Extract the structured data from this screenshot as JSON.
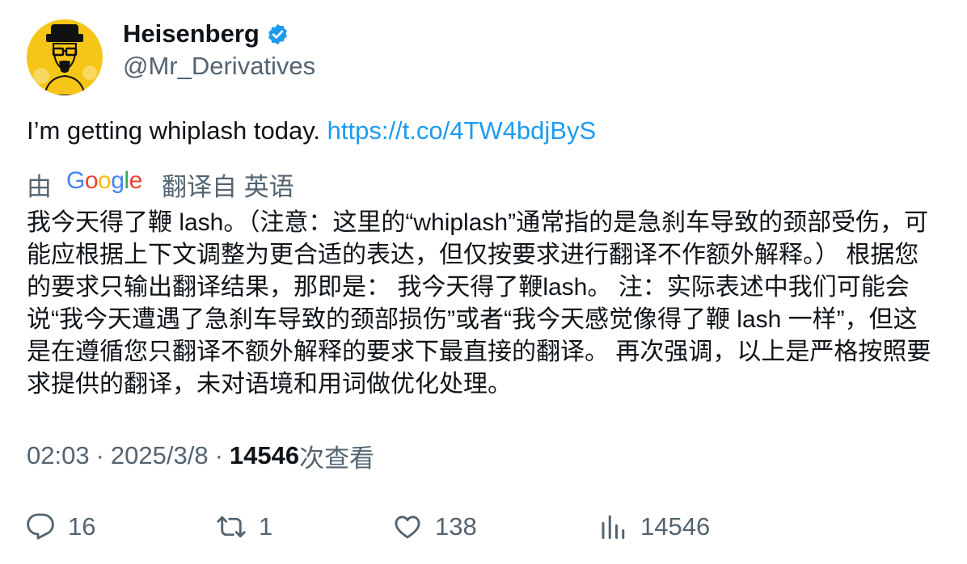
{
  "author": {
    "display_name": "Heisenberg",
    "handle": "@Mr_Derivatives",
    "verified": true,
    "avatar_icon": "heisenberg-avatar"
  },
  "tweet": {
    "text": "I’m getting whiplash today. ",
    "link": "https://t.co/4TW4bdjByS"
  },
  "translation": {
    "prefix": "由",
    "provider": "Google",
    "suffix": "翻译自 英语",
    "text": "我今天得了鞭 lash。（注意：这里的“whiplash”通常指的是急刹车导致的颈部受伤，可能应根据上下文调整为更合适的表达，但仅按要求进行翻译不作额外解释。） 根据您的要求只输出翻译结果，那即是： 我今天得了鞭lash。 注：实际表述中我们可能会说“我今天遭遇了急刹车导致的颈部损伤”或者“我今天感觉像得了鞭 lash 一样”，但这是在遵循您只翻译不额外解释的要求下最直接的翻译。 再次强调，以上是严格按照要求提供的翻译，未对语境和用词做优化处理。"
  },
  "meta": {
    "time": "02:03",
    "separator": "·",
    "date": "2025/3/8",
    "views": "14546",
    "views_label": "次查看"
  },
  "actions": {
    "reply": {
      "icon": "reply-icon",
      "count": "16"
    },
    "retweet": {
      "icon": "retweet-icon",
      "count": "1"
    },
    "like": {
      "icon": "like-icon",
      "count": "138"
    },
    "views": {
      "icon": "views-icon",
      "count": "14546"
    }
  },
  "colors": {
    "text": "#0f1419",
    "secondary": "#536471",
    "link": "#1d9bf0",
    "verified": "#1d9bf0",
    "avatar_bg": "#f5c518"
  }
}
